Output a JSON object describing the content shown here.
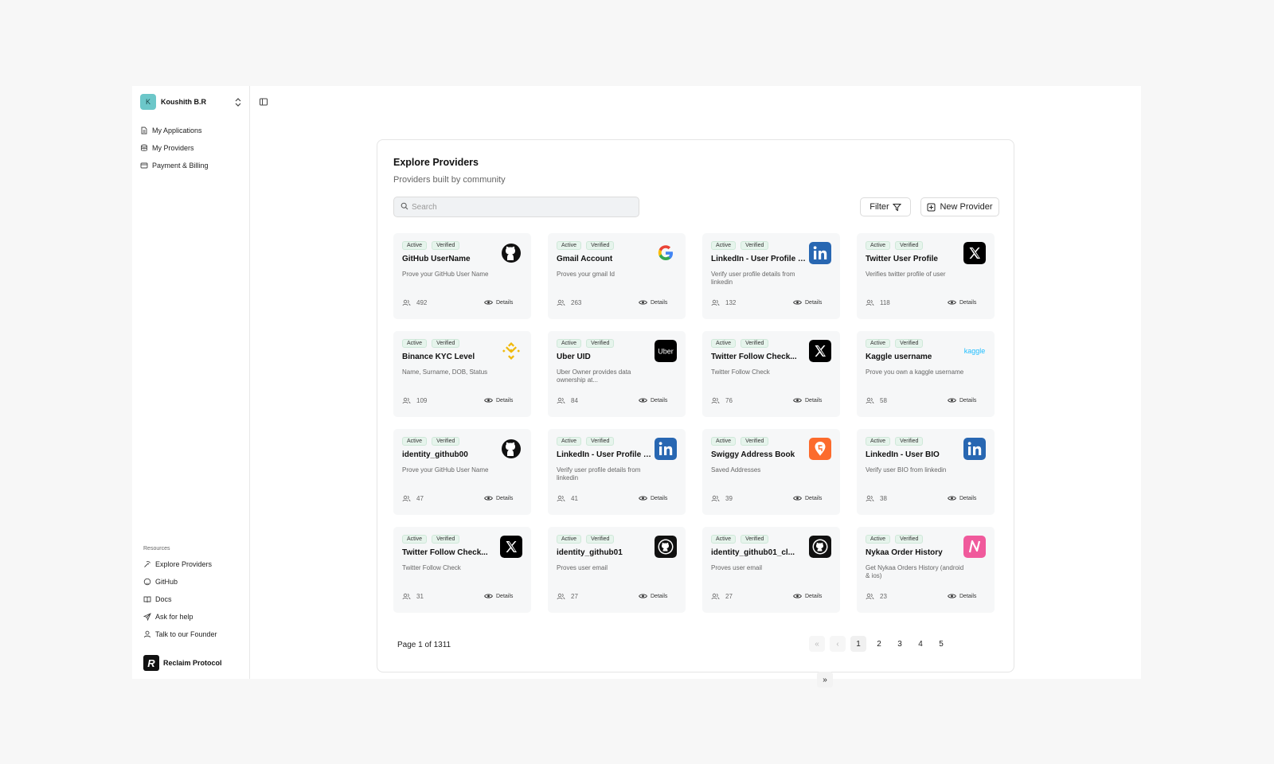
{
  "user": {
    "initial": "K",
    "name": "Koushith B.R"
  },
  "nav": [
    {
      "label": "My Applications",
      "icon": "file-icon"
    },
    {
      "label": "My Providers",
      "icon": "database-icon"
    },
    {
      "label": "Payment & Billing",
      "icon": "credit-card-icon"
    }
  ],
  "resources": {
    "title": "Resources",
    "items": [
      {
        "label": "Explore Providers",
        "icon": "pickaxe-icon"
      },
      {
        "label": "GitHub",
        "icon": "github-icon"
      },
      {
        "label": "Docs",
        "icon": "book-icon"
      },
      {
        "label": "Ask for help",
        "icon": "send-icon"
      },
      {
        "label": "Talk to our Founder",
        "icon": "user-icon"
      }
    ]
  },
  "brand": {
    "name": "Reclaim Protocol"
  },
  "panel": {
    "title": "Explore Providers",
    "subtitle": "Providers built by community",
    "search_placeholder": "Search",
    "filter_label": "Filter",
    "new_label": "New Provider",
    "details_label": "Details",
    "status_badge": "Active",
    "verified_badge": "Verified"
  },
  "cards": [
    {
      "name": "GitHub UserName",
      "desc": "Prove your GitHub User Name",
      "count": "492",
      "logo": "github"
    },
    {
      "name": "Gmail Account",
      "desc": "Proves your gmail Id",
      "count": "263",
      "logo": "google"
    },
    {
      "name": "LinkedIn - User Profile Details",
      "desc": "Verify user profile details from linkedin",
      "count": "132",
      "logo": "linkedin"
    },
    {
      "name": "Twitter User Profile",
      "desc": "Verifies twitter profile of user",
      "count": "118",
      "logo": "x"
    },
    {
      "name": "Binance KYC Level",
      "desc": "Name, Surname, DOB, Status",
      "count": "109",
      "logo": "binance"
    },
    {
      "name": "Uber UID",
      "desc": "Uber Owner provides data ownership at...",
      "count": "84",
      "logo": "uber"
    },
    {
      "name": "Twitter Follow Check...",
      "desc": "Twitter Follow Check",
      "count": "76",
      "logo": "x"
    },
    {
      "name": "Kaggle username",
      "desc": "Prove you own a kaggle username",
      "count": "58",
      "logo": "kaggle"
    },
    {
      "name": "identity_github00",
      "desc": "Prove your GitHub User Name",
      "count": "47",
      "logo": "github"
    },
    {
      "name": "LinkedIn - User Profile Details",
      "desc": "Verify user profile details from linkedin",
      "count": "41",
      "logo": "linkedin"
    },
    {
      "name": "Swiggy Address Book",
      "desc": "Saved Addresses",
      "count": "39",
      "logo": "swiggy"
    },
    {
      "name": "LinkedIn - User BIO",
      "desc": "Verify user BIO from linkedin",
      "count": "38",
      "logo": "linkedin"
    },
    {
      "name": "Twitter Follow Check...",
      "desc": "Twitter Follow Check",
      "count": "31",
      "logo": "x"
    },
    {
      "name": "identity_github01",
      "desc": "Proves user email",
      "count": "27",
      "logo": "github-square"
    },
    {
      "name": "identity_github01_cl...",
      "desc": "Proves user email",
      "count": "27",
      "logo": "github-square"
    },
    {
      "name": "Nykaa Order History",
      "desc": "Get Nykaa Orders History (android & ios)",
      "count": "23",
      "logo": "nykaa"
    }
  ],
  "pagination": {
    "label": "Page 1 of 1311",
    "pages": [
      "1",
      "2",
      "3",
      "4",
      "5"
    ],
    "first": "«",
    "prev": "‹",
    "next": "›",
    "last": "»"
  },
  "colors": {
    "avatar": "#6cc7c9",
    "badge_bg": "#e6f4ec",
    "linkedin": "#2867b2",
    "swiggy": "#fc6b2d",
    "binance": "#f0b90b",
    "kaggle": "#20beff",
    "nykaa": "#e75a9b"
  }
}
